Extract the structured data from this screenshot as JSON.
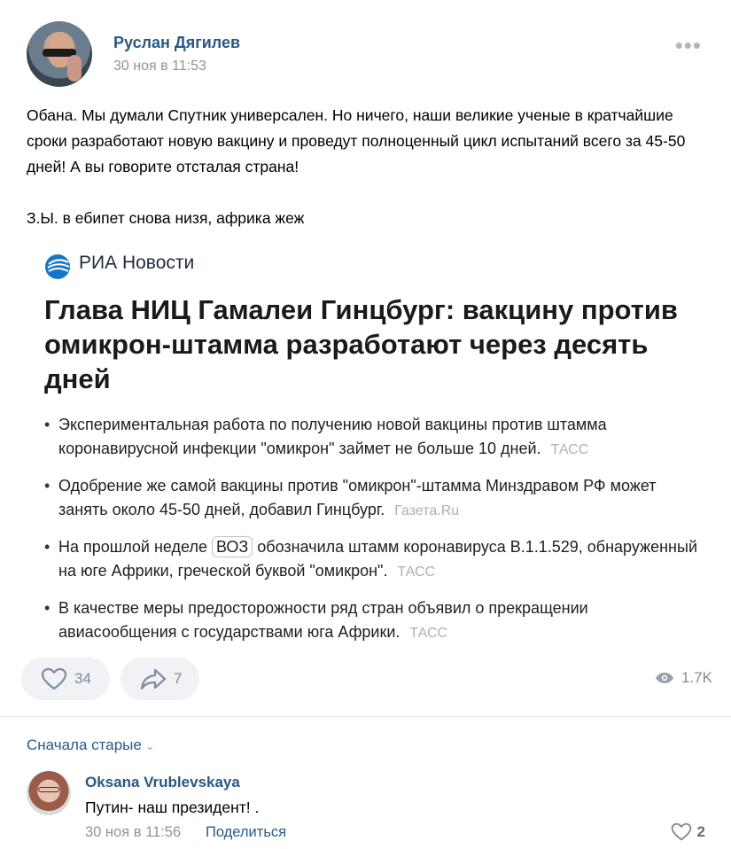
{
  "post": {
    "author": "Руслан Дягилев",
    "date": "30 ноя в 11:53",
    "more_icon": "more-horizontal-icon",
    "text_line1": "Обана. Мы думали Спутник универсален. Но ничего, наши великие ученые в кратчайшие сроки разработают новую вакцину и проведут полноценный цикл испытаний всего за 45-50 дней! А вы говорите отсталая страна!",
    "text_ps": "З.Ы. в ебипет снова низя, африка жеж"
  },
  "news_card": {
    "source_name": "РИА Новости",
    "headline": "Глава НИЦ Гамалеи Гинцбург: вакцину против омикрон-штамма разработают через десять дней",
    "bullets": [
      {
        "text": "Экспериментальная работа по получению новой вакцины против штамма коронавирусной инфекции \"омикрон\" займет не больше 10 дней.",
        "source": "ТАСС"
      },
      {
        "text": "Одобрение же самой вакцины против \"омикрон\"-штамма Минздравом РФ может занять около 45-50 дней, добавил Гинцбург.",
        "source": "Газета.Ru"
      },
      {
        "text_before": "На прошлой неделе",
        "tag": "ВОЗ",
        "text_after": "обозначила штамм коронавируса B.1.1.529, обнаруженный на юге Африки, греческой буквой \"омикрон\".",
        "source": "ТАСС"
      },
      {
        "text": "В качестве меры предосторожности ряд стран объявил о прекращении авиасообщения с государствами юга Африки.",
        "source": "ТАСС"
      }
    ]
  },
  "actions": {
    "likes": "34",
    "shares": "7",
    "views": "1.7K"
  },
  "comments": {
    "sort_label": "Сначала старые",
    "items": [
      {
        "author": "Oksana Vrublevskaya",
        "text": "Путин- наш президент! .",
        "date": "30 ноя в 11:56",
        "share_label": "Поделиться",
        "likes": "2"
      }
    ]
  },
  "colors": {
    "link": "#2a5885",
    "muted": "#939393",
    "pill_bg": "#f0f2f5"
  }
}
